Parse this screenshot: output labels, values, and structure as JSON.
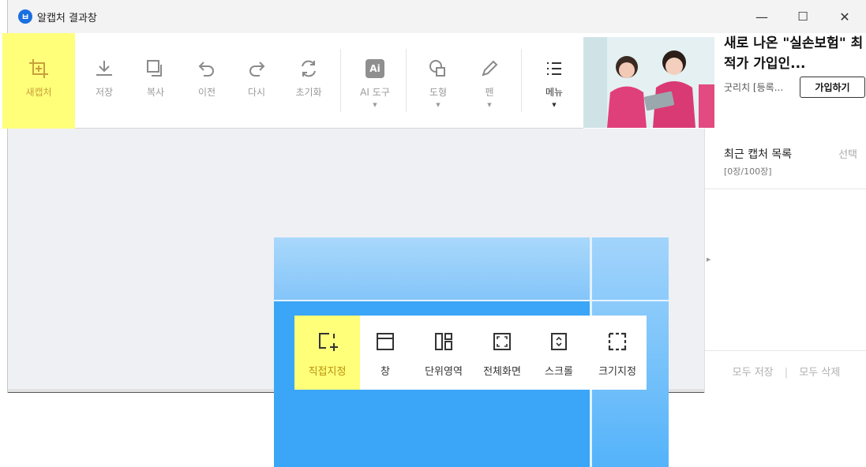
{
  "window": {
    "title": "알캡처 결과창",
    "app_icon_glyph": "ㅂ",
    "controls": {
      "minimize": "—",
      "maximize": "☐",
      "close": "✕"
    }
  },
  "toolbar": {
    "new_capture": "새캡처",
    "save": "저장",
    "copy": "복사",
    "undo": "이전",
    "redo": "다시",
    "reset": "초기화",
    "ai_tools": "AI 도구",
    "ai_glyph": "Ai",
    "shapes": "도형",
    "pen": "펜",
    "menu": "메뉴",
    "caret": "▼"
  },
  "ad": {
    "title": "새로 나온 \"실손보험\" 최적가 가입인...",
    "sub": "굿리치 [등록...",
    "button": "가입하기"
  },
  "sidebar": {
    "title": "최근 캡처 목록",
    "select": "선택",
    "count": "[0장/100장]",
    "save_all": "모두 저장",
    "divider": "|",
    "delete_all": "모두 삭제",
    "handle": "▶"
  },
  "capture_modes": {
    "direct": "직접지정",
    "window": "창",
    "region": "단위영역",
    "fullscreen": "전체화면",
    "scroll": "스크롤",
    "fixed_size": "크기지정"
  },
  "colors": {
    "highlight": "#ffff7a",
    "accent_blue": "#3ba6f7",
    "app_icon": "#1a6fe0"
  }
}
